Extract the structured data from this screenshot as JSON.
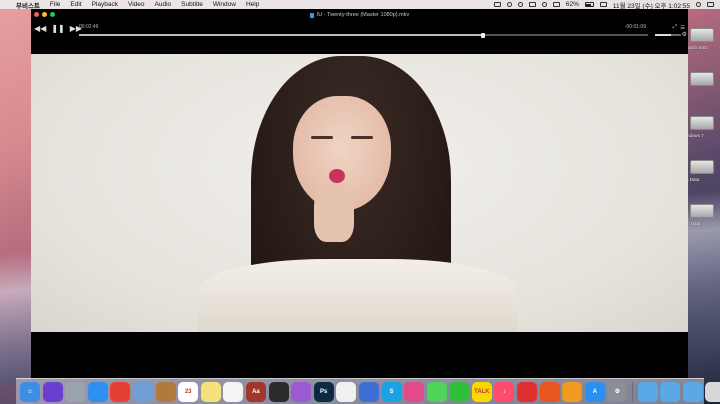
{
  "menubar": {
    "apple_glyph": "",
    "app_name": "무비스트",
    "items": [
      "File",
      "Edit",
      "Playback",
      "Video",
      "Audio",
      "Subtitle",
      "Window",
      "Help"
    ],
    "battery_percent": "62%",
    "datetime": "11월 23일 (수) 오후 1:02:55"
  },
  "player": {
    "window_title": "IU - Twenty-three (Master 1080p).mkv",
    "time_elapsed": "00:02:49",
    "time_remaining": "-00:01:09",
    "progress": 0.71,
    "volume": 0.6
  },
  "desktop": {
    "icons": [
      {
        "label": "ntosh SSD",
        "icon": "drive-icon"
      },
      {
        "label": "",
        "icon": "drive-icon"
      },
      {
        "label": "indows 7",
        "icon": "drive-icon"
      },
      {
        "label": "n Data",
        "icon": "drive-icon"
      },
      {
        "label": "in Data",
        "icon": "drive-icon"
      }
    ]
  },
  "dock": {
    "items": [
      {
        "name": "finder",
        "color": "#3a8ee6",
        "glyph": "☺"
      },
      {
        "name": "siri",
        "color": "#6a3fd0",
        "glyph": ""
      },
      {
        "name": "launchpad",
        "color": "#9aa3ad",
        "glyph": ""
      },
      {
        "name": "safari",
        "color": "#2f8ff0",
        "glyph": ""
      },
      {
        "name": "chrome",
        "color": "#e34133",
        "glyph": ""
      },
      {
        "name": "preview",
        "color": "#6f9fd6",
        "glyph": ""
      },
      {
        "name": "contacts",
        "color": "#b07a3c",
        "glyph": ""
      },
      {
        "name": "calendar",
        "color": "#ffffff",
        "glyph": "23"
      },
      {
        "name": "notes",
        "color": "#f6e27a",
        "glyph": ""
      },
      {
        "name": "reminders",
        "color": "#f4f4f4",
        "glyph": ""
      },
      {
        "name": "dictionary",
        "color": "#a3362b",
        "glyph": "Aa"
      },
      {
        "name": "final-cut",
        "color": "#2c2c2c",
        "glyph": ""
      },
      {
        "name": "motion",
        "color": "#9b5ad1",
        "glyph": ""
      },
      {
        "name": "photoshop",
        "color": "#0d2a45",
        "glyph": "Ps"
      },
      {
        "name": "photos",
        "color": "#f0f0f0",
        "glyph": ""
      },
      {
        "name": "keynote",
        "color": "#3c6ed6",
        "glyph": ""
      },
      {
        "name": "skype",
        "color": "#1aa2e6",
        "glyph": "S"
      },
      {
        "name": "screenshot",
        "color": "#e24a8a",
        "glyph": ""
      },
      {
        "name": "messages",
        "color": "#4fd45a",
        "glyph": ""
      },
      {
        "name": "line",
        "color": "#2fbf3a",
        "glyph": ""
      },
      {
        "name": "kakaotalk",
        "color": "#f7d900",
        "glyph": "TALK"
      },
      {
        "name": "itunes",
        "color": "#ff4b6e",
        "glyph": "♪"
      },
      {
        "name": "netease",
        "color": "#e02f2f",
        "glyph": ""
      },
      {
        "name": "app-red",
        "color": "#e8561f",
        "glyph": ""
      },
      {
        "name": "ibooks",
        "color": "#f29a1f",
        "glyph": ""
      },
      {
        "name": "app-store",
        "color": "#2a8ff2",
        "glyph": "A"
      },
      {
        "name": "system-preferences",
        "color": "#8a8f96",
        "glyph": "⚙"
      },
      {
        "name": "applications-folder",
        "color": "#5aa9e6",
        "glyph": ""
      },
      {
        "name": "documents-folder",
        "color": "#5aa9e6",
        "glyph": ""
      },
      {
        "name": "downloads-folder",
        "color": "#5aa9e6",
        "glyph": ""
      },
      {
        "name": "trash",
        "color": "#d8d8d8",
        "glyph": ""
      }
    ]
  }
}
